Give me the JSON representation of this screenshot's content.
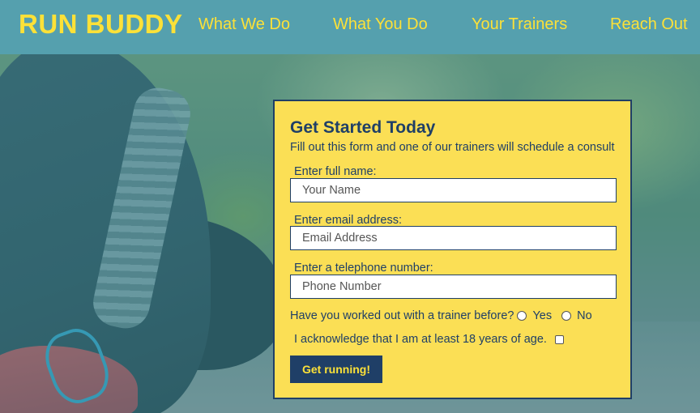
{
  "header": {
    "logo": "RUN BUDDY",
    "nav": [
      "What We Do",
      "What You Do",
      "Your Trainers",
      "Reach Out"
    ]
  },
  "form": {
    "title": "Get Started Today",
    "description": "Fill out this form and one of our trainers will schedule a consult",
    "name_label": "Enter full name:",
    "name_placeholder": "Your Name",
    "email_label": "Enter email address:",
    "email_placeholder": "Email Address",
    "phone_label": "Enter a telephone number:",
    "phone_placeholder": "Phone Number",
    "trainer_question": "Have you worked out with a trainer before?",
    "yes_label": "Yes",
    "no_label": "No",
    "age_ack": "I acknowledge that I am at least 18 years of age.",
    "submit_label": "Get running!"
  },
  "colors": {
    "header_bg": "#55a0ae",
    "accent_yellow": "#fce138",
    "form_bg": "#fbdf55",
    "navy": "#1f3f67"
  }
}
